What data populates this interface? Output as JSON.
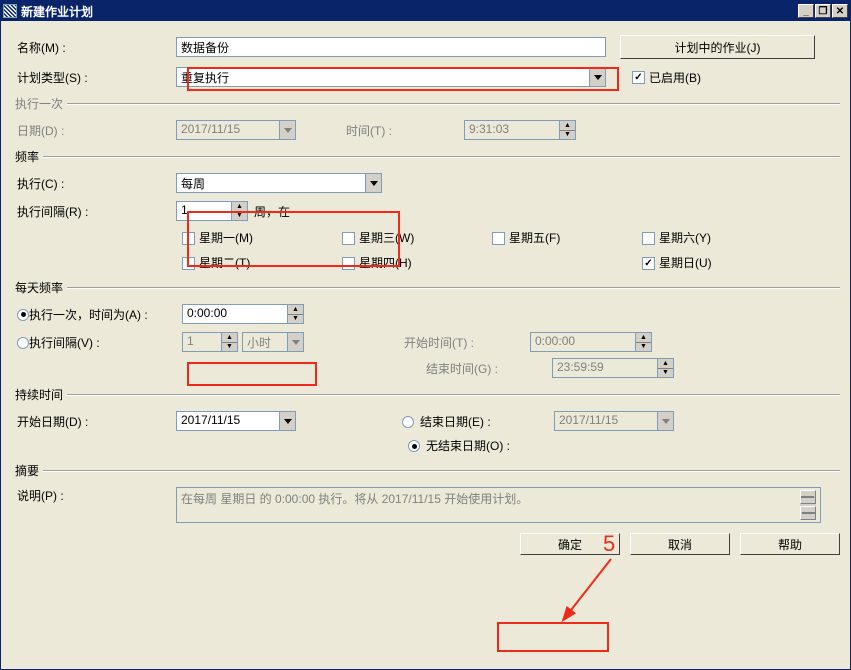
{
  "window": {
    "title": "新建作业计划",
    "min": "_",
    "restore": "❐",
    "close": "✕"
  },
  "header": {
    "name_label": "名称(M) :",
    "name_value": "数据备份",
    "jobs_btn": "计划中的作业(J)",
    "type_label": "计划类型(S) :",
    "type_value": "重复执行",
    "enabled_label": "已启用(B)"
  },
  "once": {
    "group": "执行一次",
    "date_label": "日期(D) :",
    "date_value": "2017/11/15",
    "time_label": "时间(T) :",
    "time_value": "9:31:03"
  },
  "freq": {
    "group": "频率",
    "exec_label": "执行(C) :",
    "exec_value": "每周",
    "interval_label": "执行间隔(R) :",
    "interval_value": "1",
    "interval_unit": "周，在",
    "mon": "星期一(M)",
    "tue": "星期二(T)",
    "wed": "星期三(W)",
    "thu": "星期四(H)",
    "fri": "星期五(F)",
    "sat": "星期六(Y)",
    "sun": "星期日(U)"
  },
  "daily": {
    "group": "每天频率",
    "once_label": "执行一次，时间为(A) :",
    "once_value": "0:00:00",
    "interval_label": "执行间隔(V) :",
    "interval_n": "1",
    "interval_unit": "小时",
    "start_label": "开始时间(T) :",
    "start_value": "0:00:00",
    "end_label": "结束时间(G) :",
    "end_value": "23:59:59"
  },
  "duration": {
    "group": "持续时间",
    "start_label": "开始日期(D) :",
    "start_value": "2017/11/15",
    "end_label": "结束日期(E) :",
    "end_value": "2017/11/15",
    "noend_label": "无结束日期(O) :"
  },
  "summary": {
    "group": "摘要",
    "desc_label": "说明(P) :",
    "desc_value": "在每周 星期日 的 0:00:00 执行。将从 2017/11/15 开始使用计划。"
  },
  "footer": {
    "ok": "确定",
    "cancel": "取消",
    "help": "帮助"
  },
  "annotation": {
    "five": "5"
  }
}
